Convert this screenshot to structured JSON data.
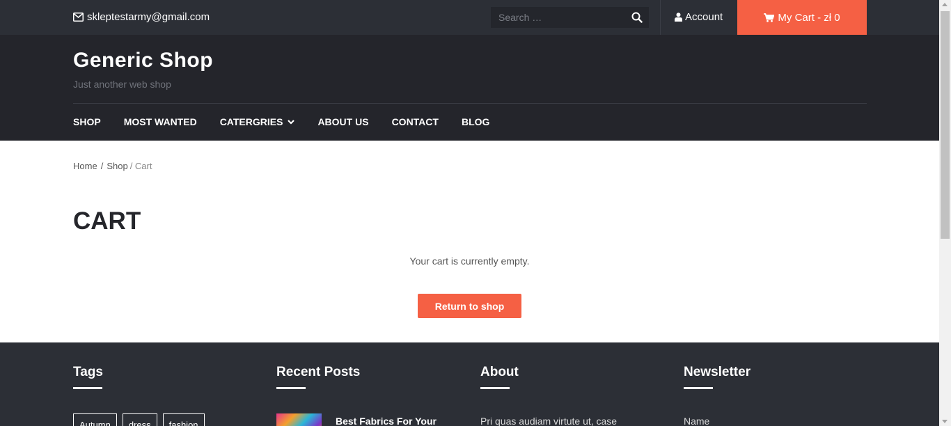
{
  "topbar": {
    "email": "skleptestarmy@gmail.com",
    "search_placeholder": "Search …",
    "account_label": "Account",
    "cart_label": "My Cart - zł 0"
  },
  "header": {
    "site_title": "Generic Shop",
    "tagline": "Just another web shop",
    "nav": [
      "SHOP",
      "MOST WANTED",
      "CATERGRIES",
      "ABOUT US",
      "CONTACT",
      "BLOG"
    ]
  },
  "breadcrumb": {
    "home": "Home",
    "sep": "/",
    "shop": "Shop",
    "current": "/ Cart"
  },
  "main": {
    "title": "CART",
    "empty_message": "Your cart is currently empty.",
    "return_button": "Return to shop"
  },
  "footer": {
    "tags_heading": "Tags",
    "tags": [
      "Autumn",
      "dress",
      "fashion"
    ],
    "recent_posts_heading": "Recent Posts",
    "recent_post_title": "Best Fabrics For Your",
    "about_heading": "About",
    "about_text": "Pri quas audiam virtute ut, case",
    "newsletter_heading": "Newsletter",
    "newsletter_name_label": "Name"
  },
  "colors": {
    "accent": "#f56044",
    "topbar_bg": "#2c2f36",
    "header_bg": "#24252b"
  }
}
